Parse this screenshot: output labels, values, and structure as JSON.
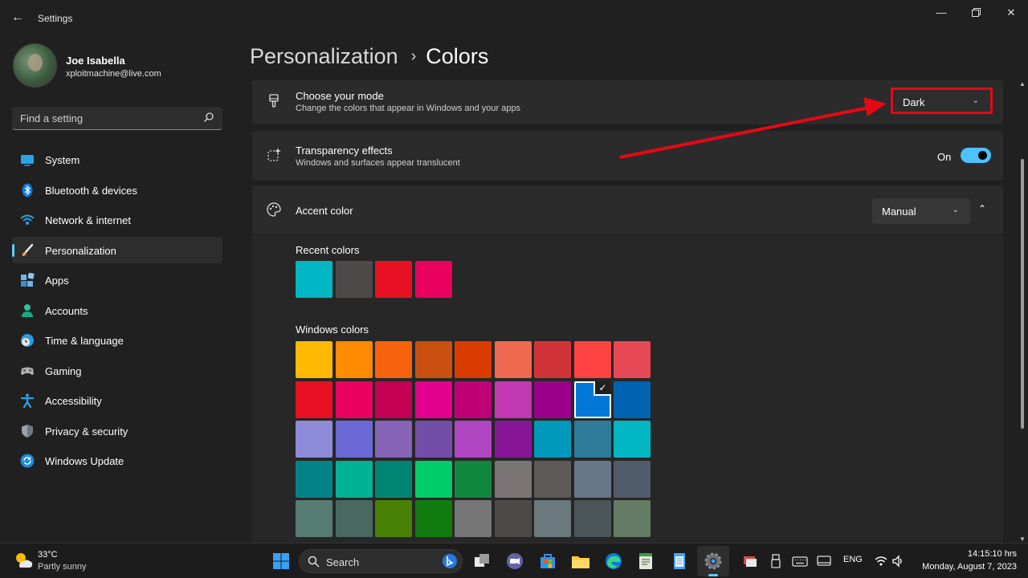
{
  "window": {
    "title": "Settings"
  },
  "user": {
    "name": "Joe Isabella",
    "email": "xploitmachine@live.com"
  },
  "search": {
    "placeholder": "Find a setting"
  },
  "sidebar": {
    "items": [
      {
        "label": "System",
        "icon": "monitor-icon"
      },
      {
        "label": "Bluetooth & devices",
        "icon": "bluetooth-icon"
      },
      {
        "label": "Network & internet",
        "icon": "wifi-icon"
      },
      {
        "label": "Personalization",
        "icon": "paintbrush-icon",
        "selected": true
      },
      {
        "label": "Apps",
        "icon": "apps-icon"
      },
      {
        "label": "Accounts",
        "icon": "person-icon"
      },
      {
        "label": "Time & language",
        "icon": "clock-globe-icon"
      },
      {
        "label": "Gaming",
        "icon": "gamepad-icon"
      },
      {
        "label": "Accessibility",
        "icon": "accessibility-icon"
      },
      {
        "label": "Privacy & security",
        "icon": "shield-icon"
      },
      {
        "label": "Windows Update",
        "icon": "refresh-icon"
      }
    ]
  },
  "breadcrumb": {
    "parent": "Personalization",
    "separator": "›",
    "current": "Colors"
  },
  "mode": {
    "title": "Choose your mode",
    "subtitle": "Change the colors that appear in Windows and your apps",
    "value": "Dark"
  },
  "transparency": {
    "title": "Transparency effects",
    "subtitle": "Windows and surfaces appear translucent",
    "state_label": "On",
    "enabled": true
  },
  "accent": {
    "title": "Accent color",
    "value": "Manual",
    "recent_label": "Recent colors",
    "windows_label": "Windows colors",
    "recent_colors": [
      "#00b7c3",
      "#4c4a48",
      "#e81123",
      "#ea005e"
    ],
    "windows_colors": [
      [
        "#ffb900",
        "#ff8c00",
        "#f7630c",
        "#ca5010",
        "#da3b01",
        "#ef6950",
        "#d13438",
        "#ff4343",
        "#e74856"
      ],
      [
        "#e81123",
        "#ea005e",
        "#c30052",
        "#e3008c",
        "#bf0077",
        "#c239b3",
        "#9a0089",
        "#0078d7",
        "#0063b1"
      ],
      [
        "#8e8cd8",
        "#6b69d6",
        "#8764b8",
        "#744da9",
        "#b146c2",
        "#881798",
        "#0099bc",
        "#2d7d9a",
        "#00b7c3"
      ],
      [
        "#038387",
        "#00b294",
        "#018574",
        "#00cc6a",
        "#10893e",
        "#7a7574",
        "#5d5a58",
        "#68768a",
        "#515c6b"
      ],
      [
        "#567c73",
        "#486860",
        "#498205",
        "#107c10",
        "#767676",
        "#4c4a48",
        "#69797e",
        "#4a5459",
        "#647c64"
      ]
    ],
    "selected_color": "#0078d7"
  },
  "annotation_color": "#e50914",
  "taskbar": {
    "weather": {
      "temp": "33°C",
      "condition": "Partly sunny"
    },
    "search_label": "Search",
    "language": "ENG",
    "time": "14:15:10 hrs",
    "date": "Monday, August 7, 2023"
  }
}
